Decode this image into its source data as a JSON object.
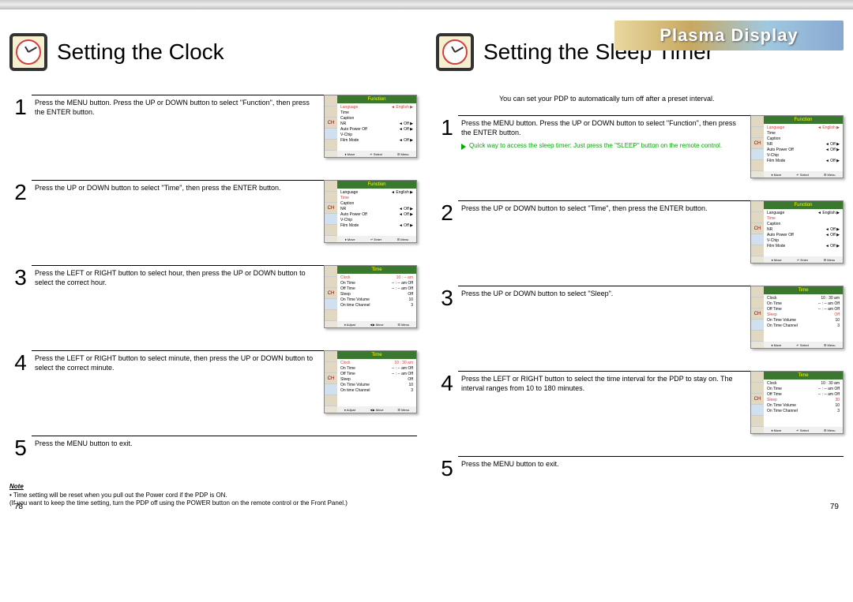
{
  "brand": "Plasma Display",
  "left_page": {
    "title": "Setting the Clock",
    "page_num": "78",
    "note_title": "Note",
    "note_body": "• Time setting will be reset when you pull out the Power cord if the PDP is ON.\n(If you want to keep the time setting, turn the PDP off using the POWER button on the remote control or the Front Panel.)",
    "steps": [
      {
        "num": "1",
        "text": "Press the MENU button. Press the UP or DOWN button to select \"Function\", then press the ENTER button."
      },
      {
        "num": "2",
        "text": "Press the UP or DOWN button to select \"Time\", then press the ENTER button."
      },
      {
        "num": "3",
        "text": "Press the LEFT or RIGHT button to select hour, then press the UP or DOWN button to select the correct hour."
      },
      {
        "num": "4",
        "text": "Press the LEFT or RIGHT button to select  minute, then press the UP or DOWN button to select the correct minute."
      },
      {
        "num": "5",
        "text": "Press the MENU button to exit."
      }
    ],
    "menus": [
      {
        "title": "Function",
        "hl": 0,
        "lines": [
          [
            "Language",
            "◄ English ▶"
          ],
          [
            "Time",
            ""
          ],
          [
            "Caption",
            ""
          ],
          [
            "NR",
            "◄ Off ▶"
          ],
          [
            "Auto Power Off",
            "◄ Off ▶"
          ],
          [
            "V-Chip",
            ""
          ],
          [
            "Film Mode",
            "◄ Off ▶"
          ]
        ],
        "footer": [
          "♦ Move",
          "↵ Select",
          "☰ Menu"
        ]
      },
      {
        "title": "Function",
        "hl": 1,
        "lines": [
          [
            "Language",
            "◄ English ▶"
          ],
          [
            "Time",
            ""
          ],
          [
            "Caption",
            ""
          ],
          [
            "NR",
            "◄ Off ▶"
          ],
          [
            "Auto Power Off",
            "◄ Off ▶"
          ],
          [
            "V-Chip",
            ""
          ],
          [
            "Film Mode",
            "◄ Off ▶"
          ]
        ],
        "footer": [
          "♦ Move",
          "↵ Enter",
          "☰ Menu"
        ]
      },
      {
        "title": "Time",
        "hl": 0,
        "lines": [
          [
            "Clock",
            "10 : -- am"
          ],
          [
            "On Time",
            "-- : -- am  Off"
          ],
          [
            "Off Time",
            "-- : -- am  Off"
          ],
          [
            "Sleep",
            "Off"
          ],
          [
            "On Time Volume",
            "10"
          ],
          [
            "On time Channel",
            "3"
          ]
        ],
        "footer": [
          "♦ Adjust",
          "◄▶ Move",
          "☰ Menu"
        ]
      },
      {
        "title": "Time",
        "hl": 0,
        "lines": [
          [
            "Clock",
            "10 : 30 am"
          ],
          [
            "On Time",
            "-- : -- am  Off"
          ],
          [
            "Off Time",
            "-- : -- am  Off"
          ],
          [
            "Sleep",
            "Off"
          ],
          [
            "On Time Volume",
            "10"
          ],
          [
            "On time Channel",
            "3"
          ]
        ],
        "footer": [
          "♦ Adjust",
          "◄▶ Move",
          "☰ Menu"
        ]
      }
    ]
  },
  "right_page": {
    "title": "Setting the Sleep Timer",
    "page_num": "79",
    "intro": "You can set your PDP to automatically turn off after a preset interval.",
    "steps": [
      {
        "num": "1",
        "text": "Press the MENU button. Press the UP or DOWN button to select \"Function\", then press the ENTER button.",
        "tip": "Quick way to access the sleep timer: Just press the \"SLEEP\" button on the remote control."
      },
      {
        "num": "2",
        "text": "Press the UP or DOWN button to select \"Time\", then press the ENTER button."
      },
      {
        "num": "3",
        "text": "Press the UP or DOWN button to select \"Sleep\"."
      },
      {
        "num": "4",
        "text": "Press the LEFT or RIGHT button to select the time interval for the PDP to stay on. The interval ranges from 10 to 180 minutes."
      },
      {
        "num": "5",
        "text": "Press the MENU button to exit."
      }
    ],
    "menus": [
      {
        "title": "Function",
        "hl": 0,
        "lines": [
          [
            "Language",
            "◄ English ▶"
          ],
          [
            "Time",
            ""
          ],
          [
            "Caption",
            ""
          ],
          [
            "NR",
            "◄ Off ▶"
          ],
          [
            "Auto Power Off",
            "◄ Off ▶"
          ],
          [
            "V-Chip",
            ""
          ],
          [
            "Film Mode",
            "◄ Off ▶"
          ]
        ],
        "footer": [
          "♦ Move",
          "↵ Select",
          "☰ Menu"
        ]
      },
      {
        "title": "Function",
        "hl": 1,
        "lines": [
          [
            "Language",
            "◄ English ▶"
          ],
          [
            "Time",
            ""
          ],
          [
            "Caption",
            ""
          ],
          [
            "NR",
            "◄ Off ▶"
          ],
          [
            "Auto Power Off",
            "◄ Off ▶"
          ],
          [
            "V-Chip",
            ""
          ],
          [
            "Film Mode",
            "◄ Off ▶"
          ]
        ],
        "footer": [
          "♦ Move",
          "↵ Enter",
          "☰ Menu"
        ]
      },
      {
        "title": "Time",
        "hl": 3,
        "lines": [
          [
            "Clock",
            "10 : 30 am"
          ],
          [
            "On Time",
            "-- : -- am  Off"
          ],
          [
            "Off Time",
            "-- : -- am  Off"
          ],
          [
            "Sleep",
            "Off"
          ],
          [
            "On Time Volume",
            "10"
          ],
          [
            "On Time Channel",
            "3"
          ]
        ],
        "footer": [
          "♦ Move",
          "↵ Select",
          "☰ Menu"
        ]
      },
      {
        "title": "Time",
        "hl": 3,
        "lines": [
          [
            "Clock",
            "10 : 30 am"
          ],
          [
            "On Time",
            "-- : -- am  Off"
          ],
          [
            "Off Time",
            "-- : -- am  Off"
          ],
          [
            "Sleep",
            "30"
          ],
          [
            "On Time Volume",
            "10"
          ],
          [
            "On Time Channel",
            "3"
          ]
        ],
        "footer": [
          "♦ Move",
          "↵ Select",
          "☰ Menu"
        ]
      }
    ]
  }
}
